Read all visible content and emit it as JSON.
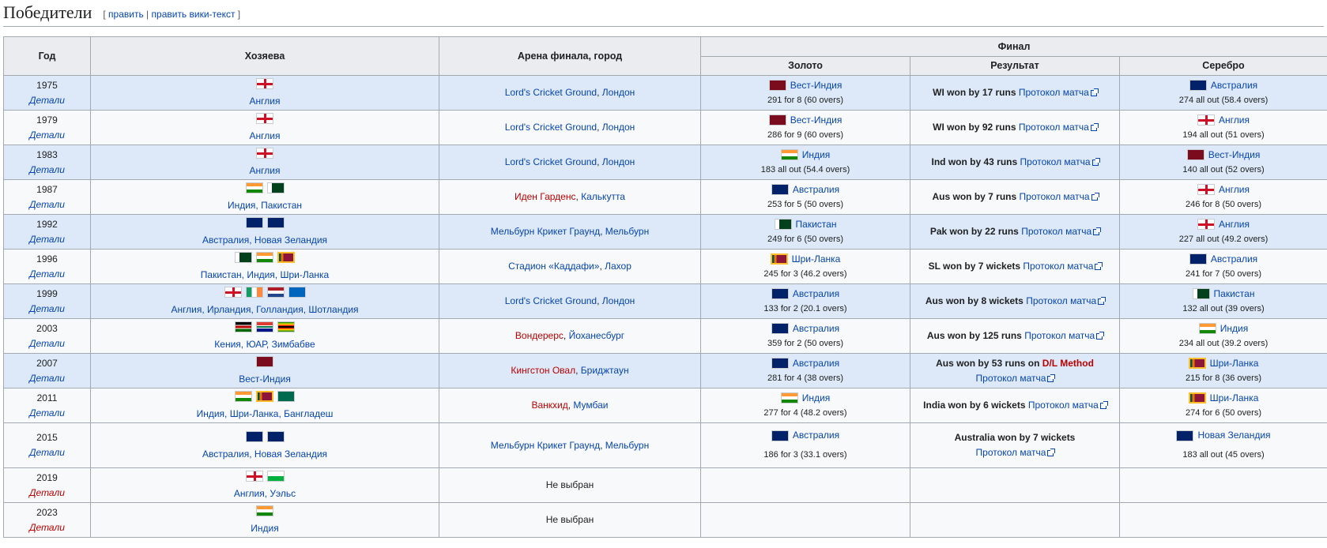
{
  "heading": {
    "title": "Победители",
    "edit": "править",
    "edit_wiki": "править вики-текст"
  },
  "table": {
    "headers": {
      "year": "Год",
      "hosts": "Хозяева",
      "venue": "Арена финала, город",
      "final": "Финал",
      "gold": "Золото",
      "result": "Результат",
      "silver": "Серебро"
    },
    "details_label": "Детали",
    "protocol_label": "Протокол матча",
    "rows": [
      {
        "year": "1975",
        "hosts": "Англия",
        "venue_link": "Lord's Cricket Ground",
        "venue_city": "Лондон",
        "gold_team": "Вест-Индия",
        "gold_score": "291 for 8 (60 overs)",
        "result": "WI won by 17 runs",
        "silver_team": "Австралия",
        "silver_score": "274 all out (58.4 overs)"
      },
      {
        "year": "1979",
        "hosts": "Англия",
        "venue_link": "Lord's Cricket Ground",
        "venue_city": "Лондон",
        "gold_team": "Вест-Индия",
        "gold_score": "286 for 9 (60 overs)",
        "result": "WI won by 92 runs",
        "silver_team": "Англия",
        "silver_score": "194 all out (51 overs)"
      },
      {
        "year": "1983",
        "hosts": "Англия",
        "venue_link": "Lord's Cricket Ground",
        "venue_city": "Лондон",
        "gold_team": "Индия",
        "gold_score": "183 all out (54.4 overs)",
        "result": "Ind won by 43 runs",
        "silver_team": "Вест-Индия",
        "silver_score": "140 all out (52 overs)"
      },
      {
        "year": "1987",
        "hosts": "Индия, Пакистан",
        "venue_link": "Иден Гарденс",
        "venue_city": "Калькутта",
        "gold_team": "Австралия",
        "gold_score": "253 for 5 (50 overs)",
        "result": "Aus won by 7 runs",
        "silver_team": "Англия",
        "silver_score": "246 for 8 (50 overs)"
      },
      {
        "year": "1992",
        "hosts": "Австралия, Новая Зеландия",
        "venue_link": "Мельбурн Крикет Граунд",
        "venue_city": "Мельбурн",
        "gold_team": "Пакистан",
        "gold_score": "249 for 6 (50 overs)",
        "result": "Pak won by 22 runs",
        "silver_team": "Англия",
        "silver_score": "227 all out (49.2 overs)"
      },
      {
        "year": "1996",
        "hosts": "Пакистан, Индия, Шри-Ланка",
        "venue_link": "Стадион «Каддафи»",
        "venue_city": "Лахор",
        "gold_team": "Шри-Ланка",
        "gold_score": "245 for 3 (46.2 overs)",
        "result": "SL won by 7 wickets",
        "silver_team": "Австралия",
        "silver_score": "241 for 7 (50 overs)"
      },
      {
        "year": "1999",
        "hosts": "Англия, Ирландия, Голландия, Шотландия",
        "venue_link": "Lord's Cricket Ground",
        "venue_city": "Лондон",
        "gold_team": "Австралия",
        "gold_score": "133 for 2 (20.1 overs)",
        "result": "Aus won by 8 wickets",
        "silver_team": "Пакистан",
        "silver_score": "132 all out (39 overs)"
      },
      {
        "year": "2003",
        "hosts": "Кения, ЮАР, Зимбабве",
        "venue_link": "Вондерерс",
        "venue_city": "Йоханесбург",
        "gold_team": "Австралия",
        "gold_score": "359 for 2 (50 overs)",
        "result": "Aus won by 125 runs",
        "silver_team": "Индия",
        "silver_score": "234 all out (39.2 overs)"
      },
      {
        "year": "2007",
        "hosts": "Вест-Индия",
        "venue_link": "Кингстон Овал",
        "venue_city": "Бриджтаун",
        "gold_team": "Австралия",
        "gold_score": "281 for 4 (38 overs)",
        "result": "Aus won by 53 runs on",
        "result_link": "D/L Method",
        "silver_team": "Шри-Ланка",
        "silver_score": "215 for 8 (36 overs)"
      },
      {
        "year": "2011",
        "hosts": "Индия, Шри-Ланка, Бангладеш",
        "venue_link": "Ванкхид",
        "venue_city": "Мумбаи",
        "gold_team": "Индия",
        "gold_score": "277 for 4 (48.2 overs)",
        "result": "India won by 6 wickets",
        "silver_team": "Шри-Ланка",
        "silver_score": "274 for 6 (50 overs)"
      },
      {
        "year": "2015",
        "hosts": "Австралия, Новая Зеландия",
        "venue_link": "Мельбурн Крикет Граунд",
        "venue_city": "Мельбурн",
        "gold_team": "Австралия",
        "gold_score": "186 for 3 (33.1 overs)",
        "result": "Australia won by 7 wickets",
        "silver_team": "Новая Зеландия",
        "silver_score": "183 all out (45 overs)"
      },
      {
        "year": "2019",
        "hosts": "Англия, Уэльс",
        "venue_plain": "Не выбран"
      },
      {
        "year": "2023",
        "hosts": "Индия",
        "venue_plain": "Не выбран"
      }
    ]
  }
}
